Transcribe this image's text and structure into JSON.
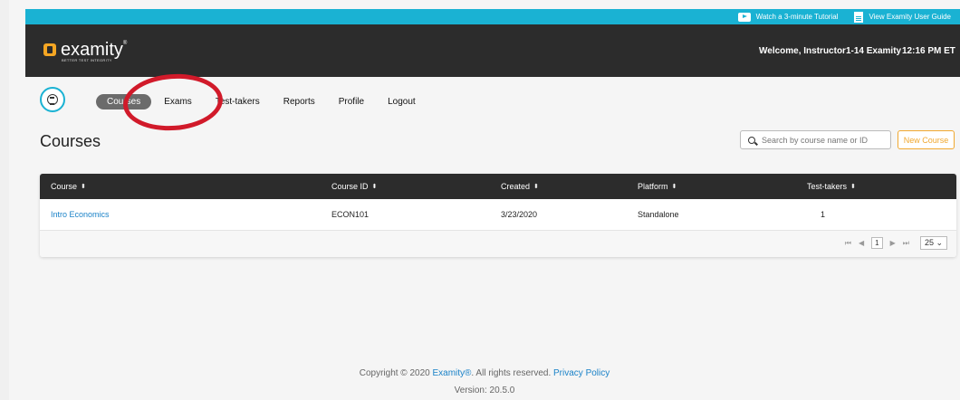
{
  "topbar": {
    "tutorial": "Watch a 3-minute Tutorial",
    "guide": "View Examity User Guide",
    "color": "#1ab2d3"
  },
  "header": {
    "logo": "examity",
    "logo_tm": "®",
    "tagline": "BETTER TEST INTEGRITY",
    "welcome": "Welcome, Instructor1-14 Examity",
    "time": "12:16 PM  ET"
  },
  "nav": {
    "courses": "Courses",
    "exams": "Exams",
    "test_takers": "Test-takers",
    "reports": "Reports",
    "profile": "Profile",
    "logout": "Logout"
  },
  "page": {
    "title": "Courses",
    "search_placeholder": "Search by course name or ID",
    "new_course": "New Course"
  },
  "table": {
    "columns": [
      "Course",
      "Course ID",
      "Created",
      "Platform",
      "Test-takers"
    ],
    "sort_glyph": "⬍",
    "rows": [
      {
        "course": "Intro Economics",
        "course_id": "ECON101",
        "created": "3/23/2020",
        "platform": "Standalone",
        "test_takers": "1"
      }
    ]
  },
  "pager": {
    "first": "⏮",
    "prev": "◀",
    "page": "1",
    "next": "▶",
    "last": "⏭",
    "page_size": "25 ⌄"
  },
  "footer": {
    "copyright": "Copyright © 2020",
    "brand": "Examity®",
    "rights": ". All rights reserved.",
    "privacy": "Privacy Policy",
    "version": "Version: 20.5.0"
  },
  "colors": {
    "accent": "#1ab2d3",
    "dark": "#2c2c2c",
    "orange": "#f0a830",
    "link": "#1a82c8",
    "annotation": "#d11a2a"
  }
}
